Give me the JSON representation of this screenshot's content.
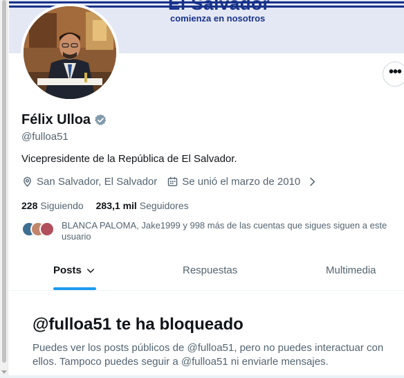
{
  "banner": {
    "title": "El Salvador",
    "subtitle": "comienza en nosotros"
  },
  "profile": {
    "name": "Félix Ulloa",
    "handle": "@fulloa51",
    "bio": "Vicepresidente de la República de El Salvador.",
    "location": "San Salvador, El Salvador",
    "joined": "Se unió el marzo de 2010"
  },
  "stats": {
    "following_count": "228",
    "following_label": "Siguiendo",
    "followers_count": "283,1 mil",
    "followers_label": "Seguidores"
  },
  "mutual": {
    "text": "BLANCA PALOMA, Jake1999 y 998 más de las cuentas que sigues siguen a este usuario"
  },
  "tabs": [
    {
      "label": "Posts"
    },
    {
      "label": "Respuestas"
    },
    {
      "label": "Multimedia"
    }
  ],
  "blocked": {
    "title": "@fulloa51 te ha bloqueado",
    "message": "Puedes ver los posts públicos de @fulloa51, pero no puedes interactuar con ellos. Tampoco puedes seguir a @fulloa51 ni enviarle mensajes."
  },
  "colors": {
    "accent": "#1d9bf0",
    "verified_badge": "#829aab",
    "banner_blue": "#17328a"
  }
}
